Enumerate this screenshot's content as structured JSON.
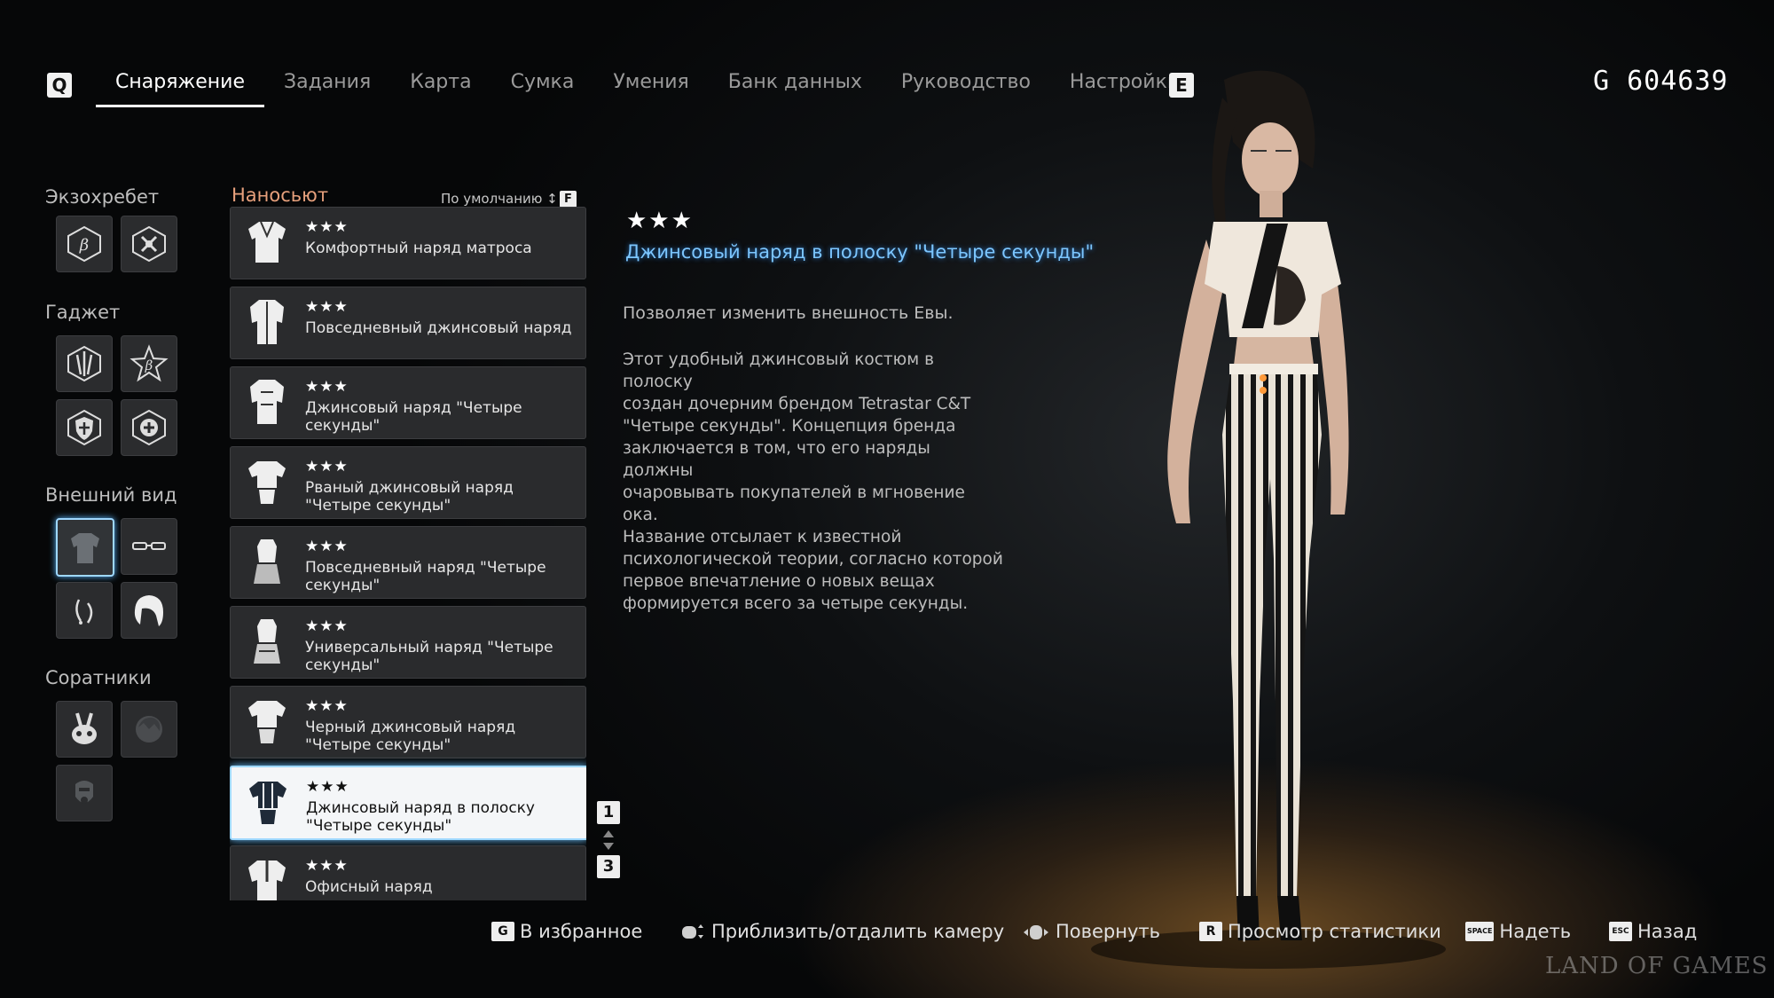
{
  "nav": {
    "left_key": "Q",
    "right_key": "E",
    "tabs": [
      "Снаряжение",
      "Задания",
      "Карта",
      "Сумка",
      "Умения",
      "Банк данных",
      "Руководство",
      "Настройки"
    ],
    "currency": "G  604639"
  },
  "categories": {
    "exospine": "Экзохребет",
    "gadget": "Гаджет",
    "appearance": "Внешний вид",
    "companions": "Соратники"
  },
  "list": {
    "title": "Наносьют",
    "sort_label": "По умолчанию ↕",
    "sort_key": "F",
    "items": [
      {
        "stars": "★★★",
        "name": "Комфортный наряд матроса"
      },
      {
        "stars": "★★★",
        "name": "Повседневный джинсовый наряд"
      },
      {
        "stars": "★★★",
        "name": "Джинсовый наряд \"Четыре секунды\""
      },
      {
        "stars": "★★★",
        "name": "Рваный джинсовый наряд \"Четыре секунды\""
      },
      {
        "stars": "★★★",
        "name": "Повседневный наряд \"Четыре секунды\""
      },
      {
        "stars": "★★★",
        "name": "Универсальный наряд \"Четыре секунды\""
      },
      {
        "stars": "★★★",
        "name": "Черный джинсовый наряд \"Четыре секунды\""
      },
      {
        "stars": "★★★",
        "name": "Джинсовый наряд в полоску \"Четыре секунды\""
      },
      {
        "stars": "★★★",
        "name": "Офисный наряд"
      }
    ],
    "page_current": "1",
    "page_total": "3"
  },
  "detail": {
    "stars": "★★★",
    "title": "Джинсовый наряд в полоску \"Четыре секунды\"",
    "short": "Позволяет изменить внешность Евы.",
    "long": "Этот удобный джинсовый костюм в полоску\nсоздан дочерним брендом Tetrastar C&T\n\"Четыре секунды\". Концепция бренда\nзаключается в том, что его наряды должны\nочаровывать покупателей в мгновение ока.\nНазвание отсылает к известной\nпсихологической теории,  согласно которой\nпервое впечатление о новых вещах\nформируется всего за четыре секунды."
  },
  "hints": [
    {
      "key": "G",
      "label": "В избранное"
    },
    {
      "key": "",
      "label": "Приблизить/отдалить камеру"
    },
    {
      "key": "",
      "label": "Повернуть"
    },
    {
      "key": "R",
      "label": "Просмотр статистики"
    },
    {
      "key": "SPACE",
      "label": "Надеть"
    },
    {
      "key": "ESC",
      "label": "Назад"
    }
  ],
  "watermark": "LAND OF GAMES"
}
